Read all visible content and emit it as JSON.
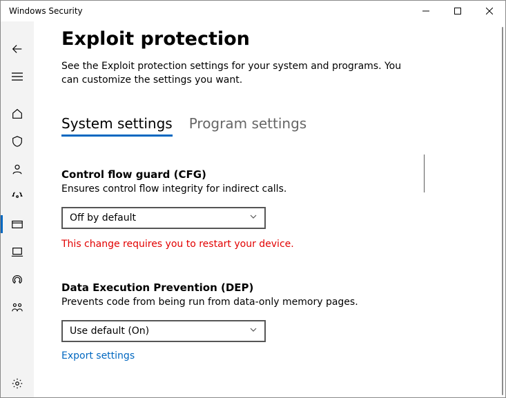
{
  "window": {
    "title": "Windows Security"
  },
  "page": {
    "title": "Exploit protection",
    "description": "See the Exploit protection settings for your system and programs.  You can customize the settings you want."
  },
  "tabs": {
    "system": "System settings",
    "program": "Program settings"
  },
  "settings": {
    "cfg": {
      "title": "Control flow guard (CFG)",
      "description": "Ensures control flow integrity for indirect calls.",
      "value": "Off by default",
      "warning": "This change requires you to restart your device."
    },
    "dep": {
      "title": "Data Execution Prevention (DEP)",
      "description": "Prevents code from being run from data-only memory pages.",
      "value": "Use default (On)"
    }
  },
  "links": {
    "export": "Export settings"
  }
}
